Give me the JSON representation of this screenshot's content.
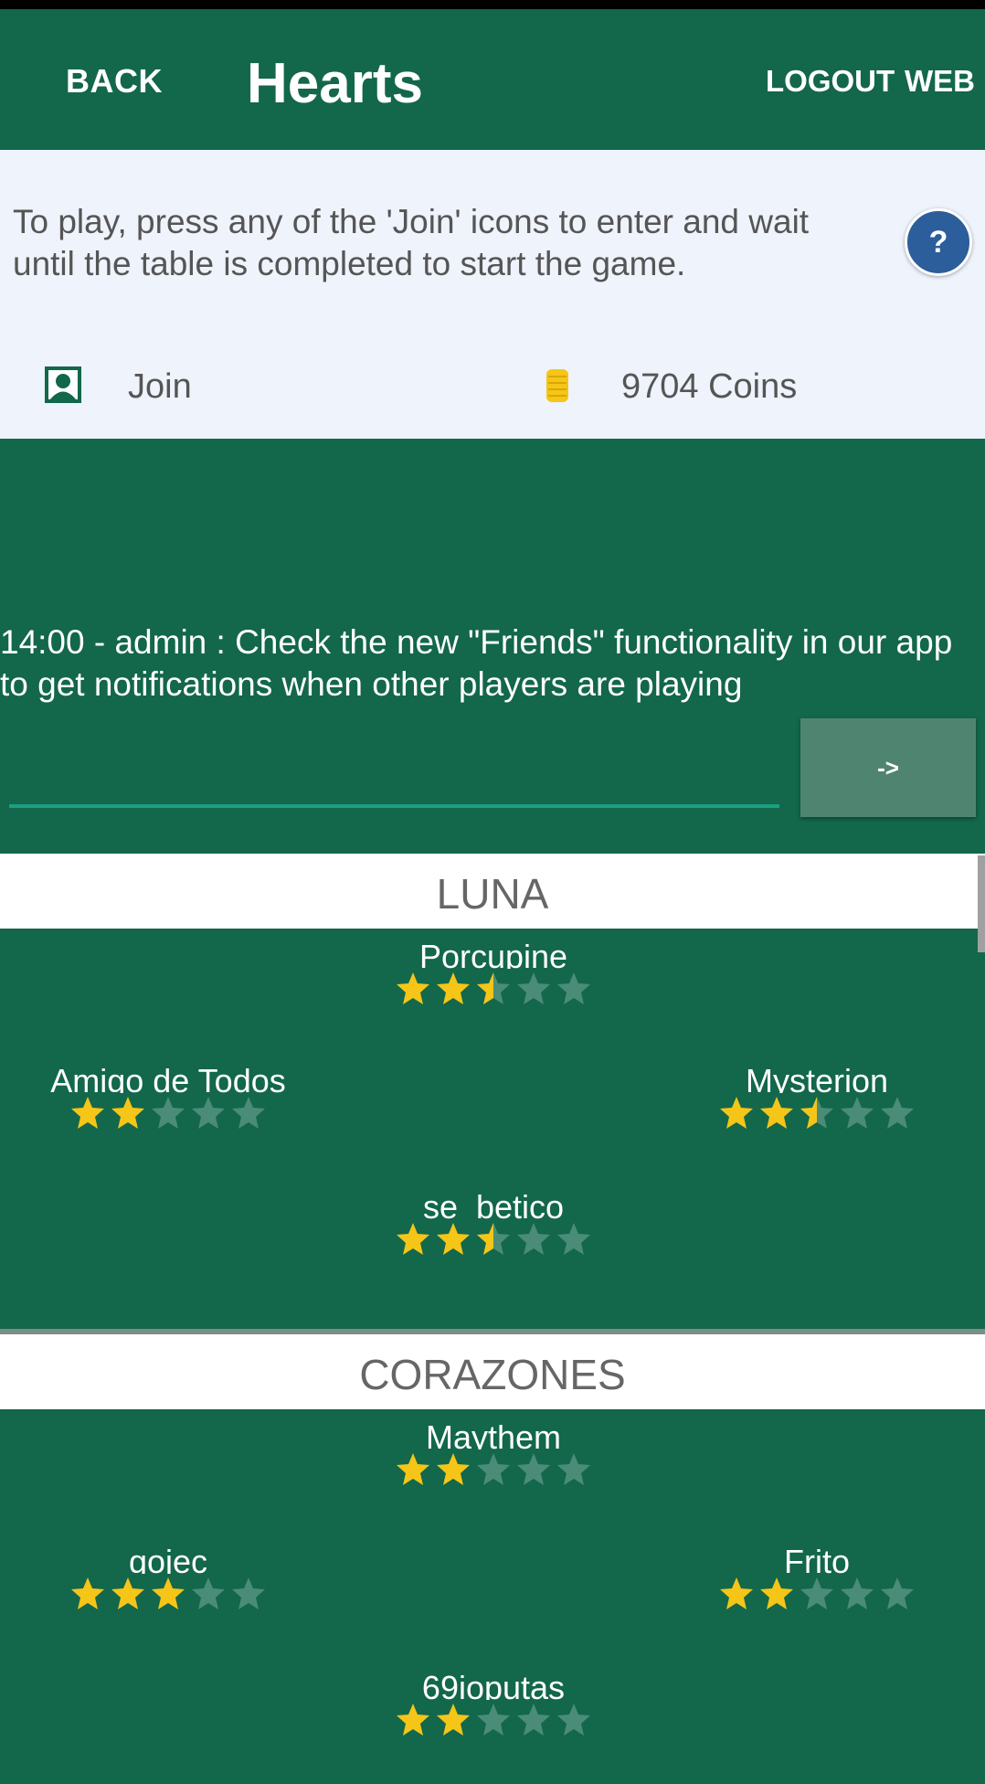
{
  "app_bar": {
    "back": "BACK",
    "title": "Hearts",
    "logout": "LOGOUT",
    "web": "WEB"
  },
  "info": {
    "instructions": "To play, press any of the 'Join' icons to enter and wait until the table is completed to start the game.",
    "help": "?",
    "join_label": "Join",
    "coins": "9704 Coins"
  },
  "chat": {
    "message": "14:00 - admin : Check the new \"Friends\" functionality in our app to get notifications when other players are playing",
    "input_value": "",
    "send_label": "->"
  },
  "tables": [
    {
      "name": "LUNA",
      "players": [
        {
          "seat": "top",
          "name": "Porcupine",
          "rating": 2.5
        },
        {
          "seat": "left",
          "name": "Amigo de Todos",
          "rating": 2
        },
        {
          "seat": "right",
          "name": "Mysterion",
          "rating": 2.5
        },
        {
          "seat": "bottom",
          "name": "se_betico",
          "rating": 2.5
        }
      ]
    },
    {
      "name": "CORAZONES",
      "players": [
        {
          "seat": "top",
          "name": "Maythem",
          "rating": 2
        },
        {
          "seat": "left",
          "name": "gojec",
          "rating": 3
        },
        {
          "seat": "right",
          "name": "Frito",
          "rating": 2
        },
        {
          "seat": "bottom",
          "name": "69ioputas",
          "rating": 2
        }
      ]
    }
  ],
  "colors": {
    "primary": "#13674b",
    "star_filled": "#f5c518",
    "star_empty": "#4a8c78",
    "help_button": "#2b5e9a"
  }
}
